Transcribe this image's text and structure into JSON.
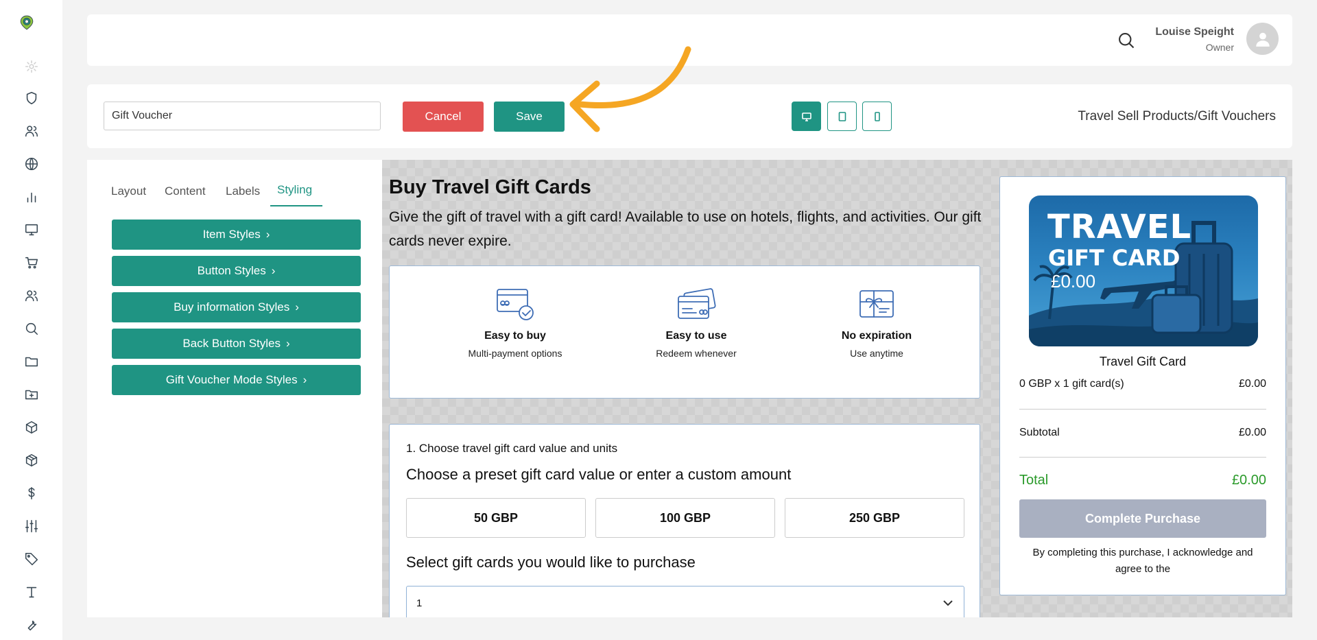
{
  "header": {
    "user_name": "Louise Speight",
    "user_role": "Owner"
  },
  "toolbar": {
    "name_value": "Gift Voucher",
    "cancel_label": "Cancel",
    "save_label": "Save",
    "breadcrumb": "Travel Sell Products/Gift Vouchers"
  },
  "panel": {
    "tabs": [
      "Layout",
      "Content",
      "Labels",
      "Styling"
    ],
    "style_buttons": [
      "Item Styles",
      "Button Styles",
      "Buy information Styles",
      "Back Button Styles",
      "Gift Voucher Mode Styles"
    ]
  },
  "preview": {
    "title": "Buy Travel Gift Cards",
    "description": "Give the gift of travel with a gift card! Available to use on hotels, flights, and activities. Our gift cards never expire.",
    "features": [
      {
        "title": "Easy to buy",
        "subtitle": "Multi-payment options",
        "icon": "credit-card-check-icon"
      },
      {
        "title": "Easy to use",
        "subtitle": "Redeem whenever",
        "icon": "cards-icon"
      },
      {
        "title": "No expiration",
        "subtitle": "Use anytime",
        "icon": "gift-card-icon"
      }
    ],
    "step_label": "1. Choose travel gift card value and units",
    "choose_heading": "Choose a preset gift card value or enter a custom amount",
    "amounts": [
      "50 GBP",
      "100 GBP",
      "250 GBP"
    ],
    "quantity_heading": "Select gift cards you would like to purchase",
    "quantity_value": "1"
  },
  "summary": {
    "card_line1": "TRAVEL",
    "card_line2": "GIFT CARD",
    "card_amount": "£0.00",
    "item_name": "Travel Gift Card",
    "line_label": "0 GBP x 1 gift card(s)",
    "line_value": "£0.00",
    "subtotal_label": "Subtotal",
    "subtotal_value": "£0.00",
    "total_label": "Total",
    "total_value": "£0.00",
    "button_label": "Complete Purchase",
    "terms": "By completing this purchase, I acknowledge and agree to the"
  },
  "colors": {
    "accent": "#1f9483",
    "cancel": "#e35252",
    "arrow": "#f5a623",
    "total": "#2a9a2a",
    "disabled_button": "#a9b0c1"
  }
}
